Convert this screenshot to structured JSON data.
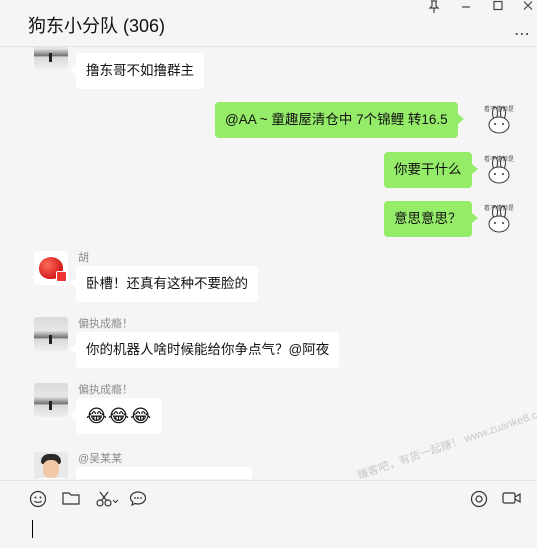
{
  "window": {
    "title": "狗东小分队 (306)",
    "pin_icon": "pin-icon",
    "more_icon": "more-icon"
  },
  "messages": [
    {
      "side": "left",
      "name": "",
      "text": "撸东哥不如撸群主",
      "avatar": "grayscale-photo-avatar"
    },
    {
      "side": "right",
      "text": "@AA ~ 童趣屋清仓中   7个锦鲤 转16.5",
      "avatar": "rabbit-avatar"
    },
    {
      "side": "right",
      "text": "你要干什么",
      "avatar": "rabbit-avatar"
    },
    {
      "side": "right",
      "text": "意思意思？",
      "avatar": "rabbit-avatar"
    },
    {
      "side": "left",
      "name": "胡",
      "text": "卧槽！还真有这种不要脸的",
      "avatar": "apple-avatar"
    },
    {
      "side": "left",
      "name": "偏执成瘾！",
      "text": "你的机器人啥时候能给你争点气？@阿夜",
      "avatar": "grayscale-photo-avatar"
    },
    {
      "side": "left",
      "name": "偏执成瘾！",
      "text": "😂😂😂",
      "avatar": "grayscale-photo-avatar"
    },
    {
      "side": "left",
      "name": "@吴某某",
      "text": "",
      "avatar": "person-avatar"
    }
  ],
  "rabbit_caption": "看不懂但是",
  "toolbar": {
    "emoji_icon": "emoji-icon",
    "folder_icon": "folder-icon",
    "scissors_icon": "scissors-icon",
    "chat_icon": "chat-icon",
    "call_icon": "call-icon",
    "video_icon": "video-icon"
  },
  "watermark": "赚客吧，有货一起赚！ www.zuanke8.com",
  "colors": {
    "background": "#f5f5f5",
    "bubble_self": "#95ec69",
    "bubble_other": "#ffffff",
    "name_text": "#8c8c8c"
  }
}
